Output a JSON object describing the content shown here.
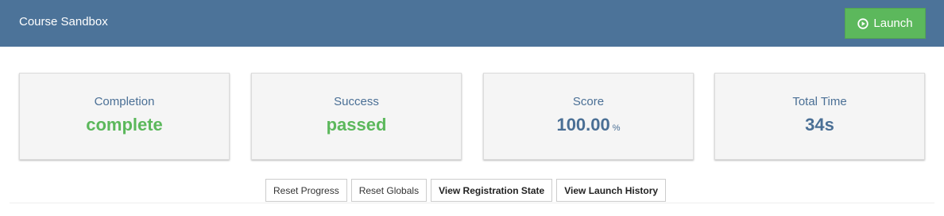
{
  "header": {
    "title": "Course Sandbox",
    "launch_label": "Launch",
    "launch_icon": "play-circle-icon",
    "background_color": "#4c7399",
    "launch_color": "#5cb85c"
  },
  "cards": [
    {
      "label": "Completion",
      "value": "complete",
      "unit": ""
    },
    {
      "label": "Success",
      "value": "passed",
      "unit": ""
    },
    {
      "label": "Score",
      "value": "100.00",
      "unit": "%"
    },
    {
      "label": "Total Time",
      "value": "34s",
      "unit": ""
    }
  ],
  "colors": {
    "status_green": "#5cb85c",
    "value_blue": "#4a6f95"
  },
  "actions": {
    "reset_progress": "Reset Progress",
    "reset_globals": "Reset Globals",
    "view_registration_state": "View Registration State",
    "view_launch_history": "View Launch History"
  }
}
